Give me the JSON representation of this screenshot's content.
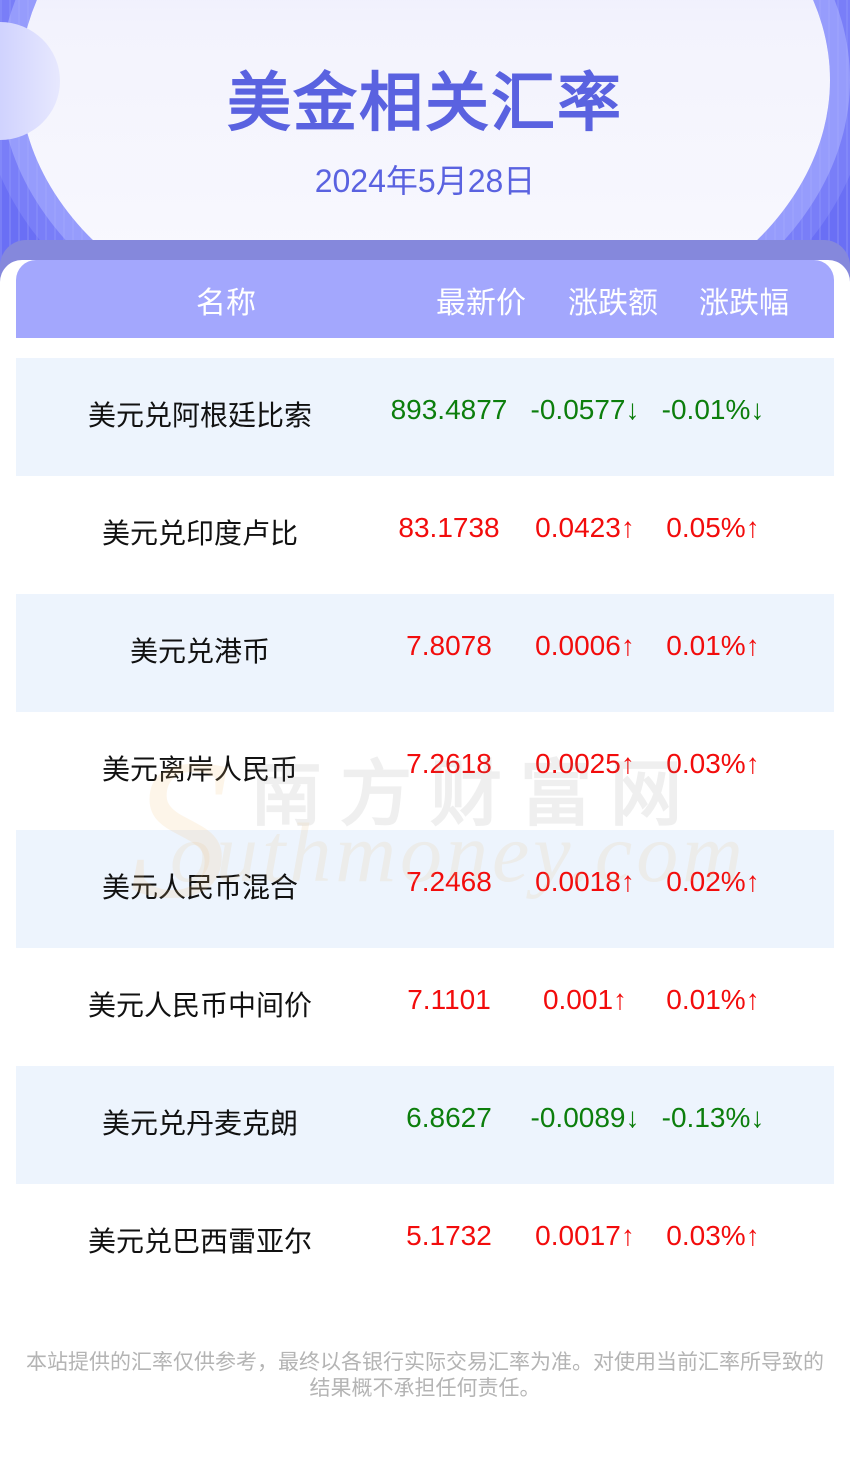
{
  "header": {
    "title": "美金相关汇率",
    "date": "2024年5月28日"
  },
  "colors": {
    "accent": "#5a62e0",
    "table_header_bg": "#a3a7fd",
    "row_alt_bg": "#edf4fd",
    "up": "#f20c0c",
    "down": "#0c7e0c"
  },
  "table": {
    "columns": [
      "名称",
      "最新价",
      "涨跌额",
      "涨跌幅"
    ],
    "rows": [
      {
        "name": "美元兑阿根廷比索",
        "price": "893.4877",
        "change": "-0.0577↓",
        "pct": "-0.01%↓",
        "direction": "down"
      },
      {
        "name": "美元兑印度卢比",
        "price": "83.1738",
        "change": "0.0423↑",
        "pct": "0.05%↑",
        "direction": "up"
      },
      {
        "name": "美元兑港币",
        "price": "7.8078",
        "change": "0.0006↑",
        "pct": "0.01%↑",
        "direction": "up"
      },
      {
        "name": "美元离岸人民币",
        "price": "7.2618",
        "change": "0.0025↑",
        "pct": "0.03%↑",
        "direction": "up"
      },
      {
        "name": "美元人民币混合",
        "price": "7.2468",
        "change": "0.0018↑",
        "pct": "0.02%↑",
        "direction": "up"
      },
      {
        "name": "美元人民币中间价",
        "price": "7.1101",
        "change": "0.001↑",
        "pct": "0.01%↑",
        "direction": "up"
      },
      {
        "name": "美元兑丹麦克朗",
        "price": "6.8627",
        "change": "-0.0089↓",
        "pct": "-0.13%↓",
        "direction": "down"
      },
      {
        "name": "美元兑巴西雷亚尔",
        "price": "5.1732",
        "change": "0.0017↑",
        "pct": "0.03%↑",
        "direction": "up"
      }
    ]
  },
  "watermark": {
    "cn": "南方财富网",
    "en": "outhmoney.com",
    "logo_letter": "S"
  },
  "disclaimer": {
    "line1": "本站提供的汇率仅供参考，最终以各银行实际交易汇率为准。对使用当前汇率所导致的",
    "line2": "结果概不承担任何责任。"
  }
}
